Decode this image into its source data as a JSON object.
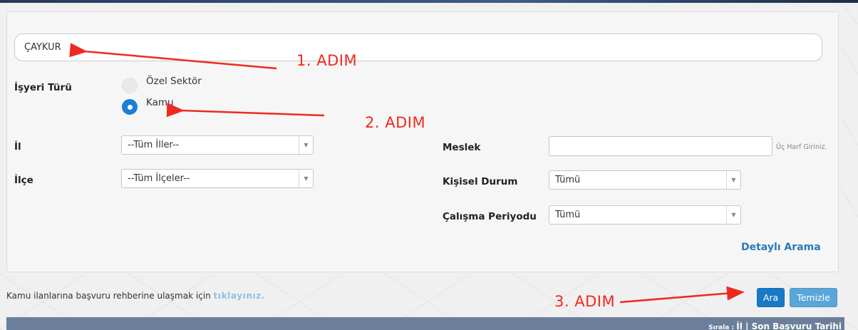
{
  "search": {
    "value": "ÇAYKUR"
  },
  "workplace_type": {
    "label": "İşyeri Türü",
    "options": [
      {
        "label": "Özel Sektör",
        "checked": false
      },
      {
        "label": "Kamu",
        "checked": true
      }
    ]
  },
  "il": {
    "label": "İl",
    "selected": "--Tüm İller--"
  },
  "ilce": {
    "label": "İlçe",
    "selected": "--Tüm İlçeler--"
  },
  "meslek": {
    "label": "Meslek",
    "value": "",
    "hint": "Üç Harf Giriniz."
  },
  "kisisel_durum": {
    "label": "Kişisel Durum",
    "selected": "Tümü"
  },
  "calisma_periyodu": {
    "label": "Çalışma Periyodu",
    "selected": "Tümü"
  },
  "detail_search": "Detaylı Arama",
  "info": {
    "text": "Kamu ilanlarına başvuru rehberine ulaşmak için ",
    "link": "tıklayınız."
  },
  "buttons": {
    "search": "Ara",
    "clear": "Temizle"
  },
  "sort": {
    "prefix": "Sırala : ",
    "text": "İl | Son Başvuru Tarihi"
  },
  "annotations": {
    "step1": "1. ADIM",
    "step2": "2. ADIM",
    "step3": "3. ADIM"
  },
  "colors": {
    "accent": "#1b7fd6",
    "annotation": "#ee2a1e",
    "link": "#2a7ab8"
  }
}
